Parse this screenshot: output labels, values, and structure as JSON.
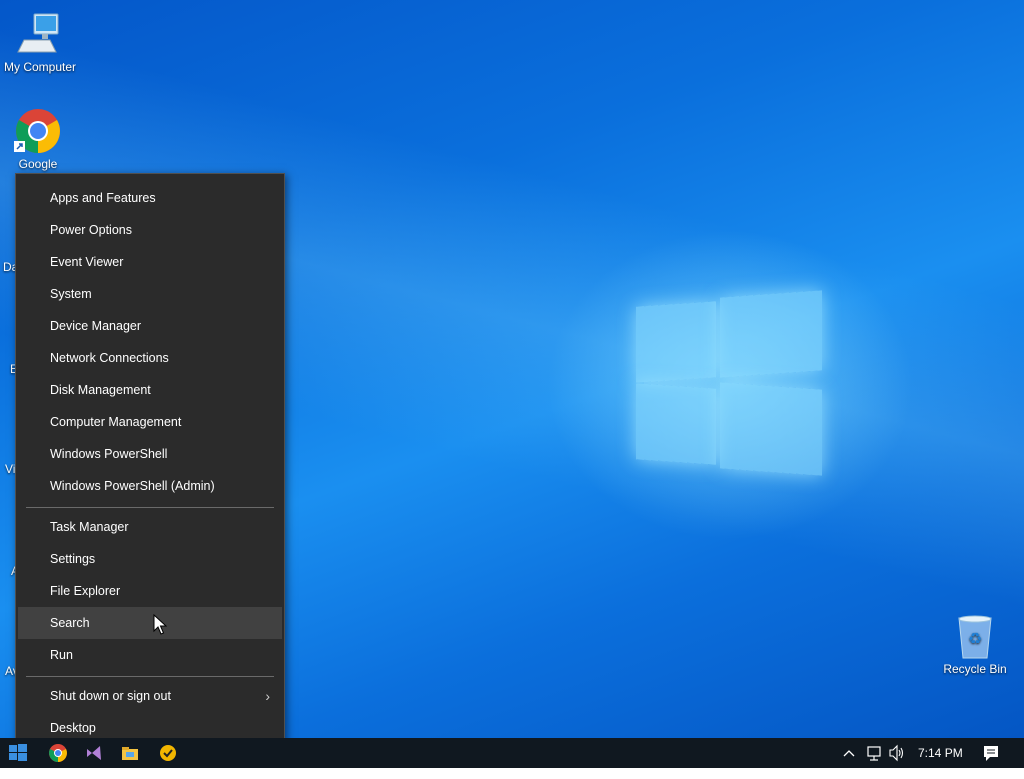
{
  "desktop": {
    "icons": {
      "my_computer": "My Computer",
      "google": "Google",
      "recycle_bin": "Recycle Bin"
    },
    "partial_labels": [
      "Da",
      "E",
      "Vi",
      "A",
      "Av"
    ]
  },
  "menu": {
    "items": [
      {
        "label": "Apps and Features"
      },
      {
        "label": "Power Options"
      },
      {
        "label": "Event Viewer"
      },
      {
        "label": "System"
      },
      {
        "label": "Device Manager"
      },
      {
        "label": "Network Connections"
      },
      {
        "label": "Disk Management"
      },
      {
        "label": "Computer Management"
      },
      {
        "label": "Windows PowerShell"
      },
      {
        "label": "Windows PowerShell (Admin)"
      },
      {
        "label": "Task Manager"
      },
      {
        "label": "Settings"
      },
      {
        "label": "File Explorer"
      },
      {
        "label": "Search"
      },
      {
        "label": "Run"
      },
      {
        "label": "Shut down or sign out"
      },
      {
        "label": "Desktop"
      }
    ],
    "hovered": "Search",
    "submenu_arrow": "›"
  },
  "taskbar": {
    "clock": "7:14 PM",
    "icons": [
      "windows-start-icon",
      "chrome-icon",
      "visual-studio-icon",
      "file-explorer-icon",
      "norton-icon"
    ],
    "tray_icons": [
      "chevron-up-icon",
      "network-icon",
      "volume-icon",
      "notification-icon"
    ]
  },
  "colors": {
    "menu_bg": "#2b2b2b",
    "menu_hover": "#414141",
    "taskbar_bg": "#101820",
    "desktop_blue": "#0a6fdc"
  }
}
